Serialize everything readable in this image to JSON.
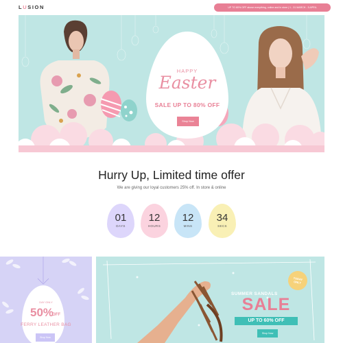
{
  "header": {
    "logo_prefix": "L",
    "logo_o": "U",
    "logo_suffix": "SION",
    "promo": "UP TO 80% OFF above everything, online and in store | 1 - 31 MARCH - 5 APRIL"
  },
  "hero": {
    "happy": "HAPPY",
    "easter": "Easter",
    "sale": "SALE UP TO 80% OFF",
    "button": "Shop Now"
  },
  "offer": {
    "title": "Hurry Up, Limited time offer",
    "subtitle": "We are giving our loyal customers 25% off. In store & online",
    "timers": [
      {
        "value": "01",
        "unit": "DAYS",
        "color": "#ddd6fb"
      },
      {
        "value": "12",
        "unit": "HOURS",
        "color": "#fbd3df"
      },
      {
        "value": "12",
        "unit": "MINS",
        "color": "#c8e5f7"
      },
      {
        "value": "34",
        "unit": "SECS",
        "color": "#f9f0b5"
      }
    ]
  },
  "bag_banner": {
    "day_only": "DAY ONLY",
    "percent": "50%",
    "off": "OFF",
    "name": "FERRY LEATHER BAG",
    "button": "Shop Now"
  },
  "sandals_banner": {
    "title": "SUMMER SANDALS",
    "sale": "SALE",
    "upto": "UP TO 60% OFF",
    "button": "Shop Now",
    "badge_line1": "TODAY",
    "badge_line2": "ONLY"
  },
  "colors": {
    "accent_pink": "#e87f95",
    "mint": "#bfe6e4",
    "lavender": "#d6d3f6",
    "teal": "#3fbfb6"
  }
}
